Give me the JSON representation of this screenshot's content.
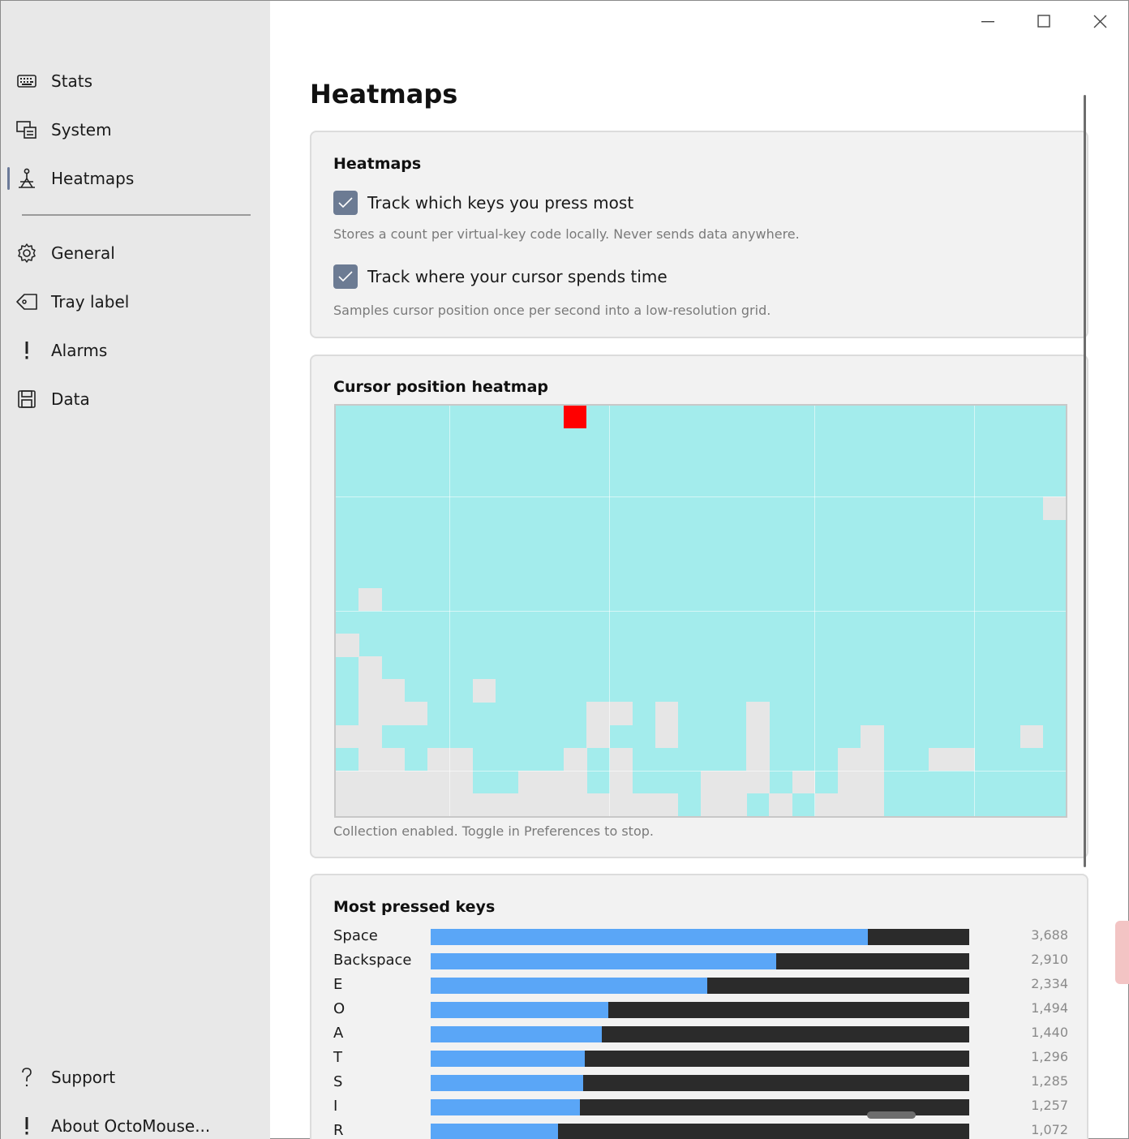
{
  "sidebar": {
    "items": [
      {
        "label": "Stats",
        "icon": "keyboard-icon"
      },
      {
        "label": "System",
        "icon": "system-icon"
      },
      {
        "label": "Heatmaps",
        "icon": "heatmap-icon",
        "selected": true
      },
      {
        "label": "General",
        "icon": "gear-icon"
      },
      {
        "label": "Tray label",
        "icon": "tag-icon"
      },
      {
        "label": "Alarms",
        "icon": "exclamation-icon"
      },
      {
        "label": "Data",
        "icon": "save-icon"
      }
    ],
    "footer": [
      {
        "label": "Support",
        "icon": "question-icon"
      },
      {
        "label": "About OctoMouse...",
        "icon": "exclamation-icon"
      }
    ]
  },
  "page": {
    "title": "Heatmaps"
  },
  "settings_card": {
    "title": "Heatmaps",
    "options": [
      {
        "label": "Track which keys you press most",
        "checked": true,
        "hint": "Stores a count per virtual-key code locally. Never sends data anywhere."
      },
      {
        "label": "Track where your cursor spends time",
        "checked": true,
        "hint": "Samples cursor position once per second into a low-resolution grid."
      }
    ]
  },
  "cursor_card": {
    "title": "Cursor position heatmap",
    "footer": "Collection enabled. Toggle in Preferences to stop.",
    "grid": {
      "cols": 32,
      "rows": 18,
      "hot_cell": [
        10,
        0
      ]
    }
  },
  "keys_card": {
    "title": "Most pressed keys",
    "max": 4540,
    "keys": [
      {
        "name": "Space",
        "count": 3688,
        "count_label": "3,688"
      },
      {
        "name": "Backspace",
        "count": 2910,
        "count_label": "2,910"
      },
      {
        "name": "E",
        "count": 2334,
        "count_label": "2,334"
      },
      {
        "name": "O",
        "count": 1494,
        "count_label": "1,494"
      },
      {
        "name": "A",
        "count": 1440,
        "count_label": "1,440"
      },
      {
        "name": "T",
        "count": 1296,
        "count_label": "1,296"
      },
      {
        "name": "S",
        "count": 1285,
        "count_label": "1,285"
      },
      {
        "name": "I",
        "count": 1257,
        "count_label": "1,257"
      },
      {
        "name": "R",
        "count": 1072,
        "count_label": "1,072"
      }
    ]
  },
  "colors": {
    "accent": "#5aa6f7",
    "heat_base": "#a3ecec",
    "heat_empty": "#e6e6e6",
    "heat_hot": "#ff0000",
    "checkbox": "#6c7b93"
  }
}
